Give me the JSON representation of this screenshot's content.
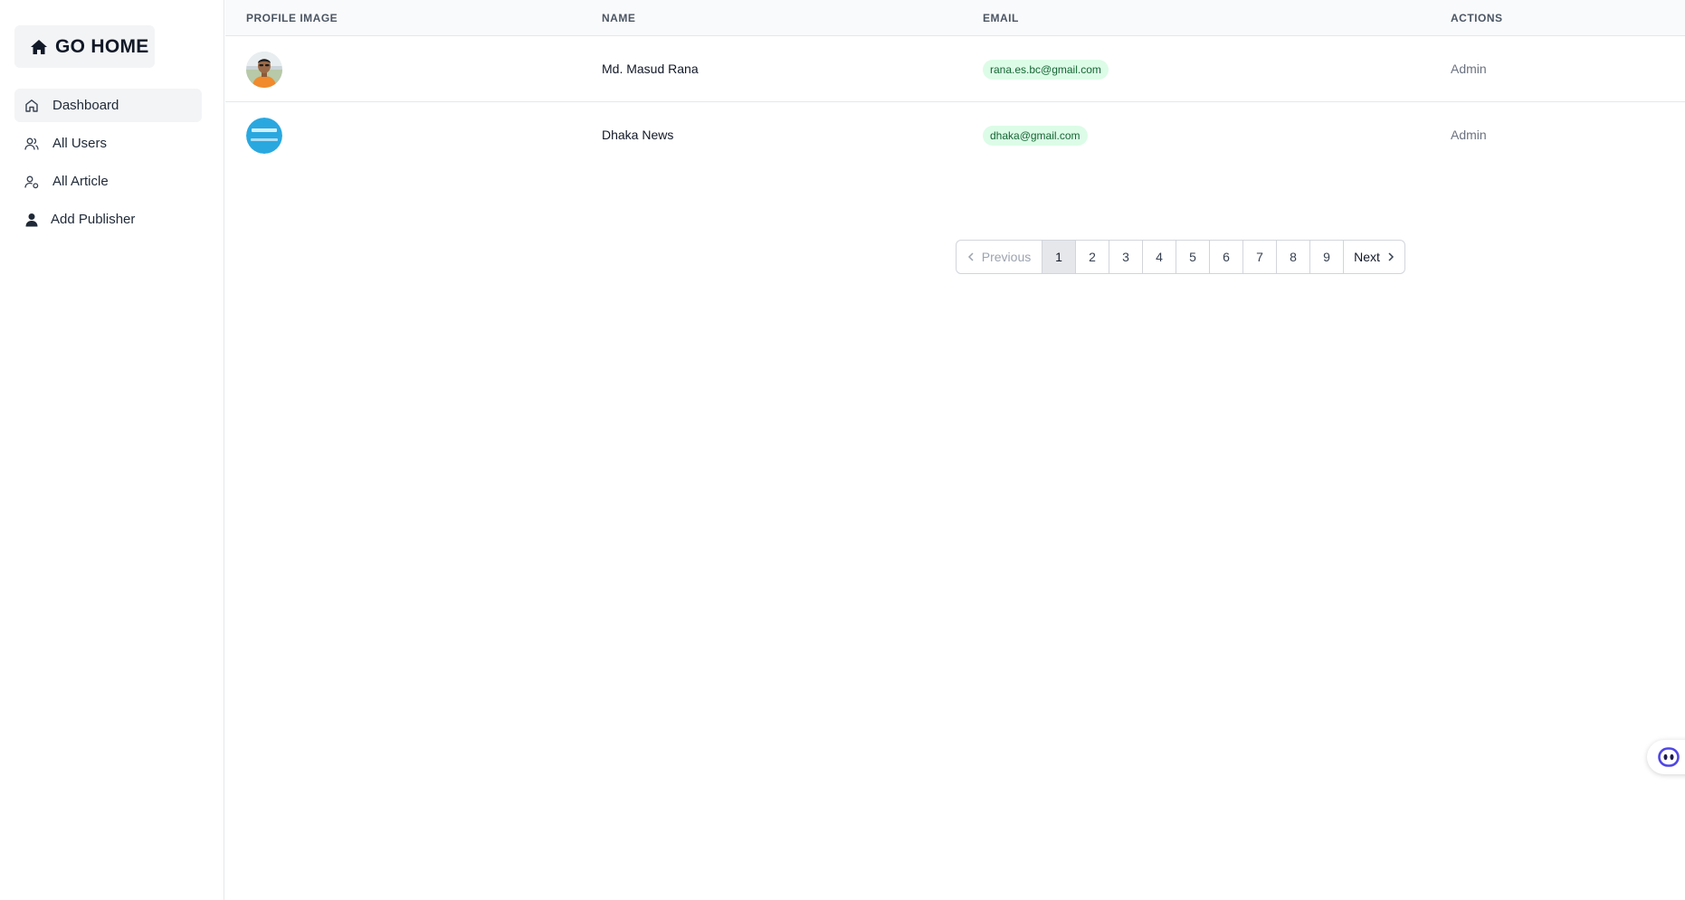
{
  "sidebar": {
    "home_label": "GO HOME",
    "items": [
      {
        "label": "Dashboard",
        "icon": "home-outline-icon",
        "active": true
      },
      {
        "label": "All Users",
        "icon": "users-icon",
        "active": false
      },
      {
        "label": "All Article",
        "icon": "user-settings-icon",
        "active": false
      },
      {
        "label": "Add Publisher",
        "icon": "user-solid-icon",
        "active": false
      }
    ]
  },
  "table": {
    "headers": [
      "PROFILE IMAGE",
      "NAME",
      "EMAIL",
      "ACTIONS"
    ],
    "rows": [
      {
        "name": "Md. Masud Rana",
        "email": "rana.es.bc@gmail.com",
        "action": "Admin",
        "avatar": "photo-avatar"
      },
      {
        "name": "Dhaka News",
        "email": "dhaka@gmail.com",
        "action": "Admin",
        "avatar": "logo-avatar"
      }
    ]
  },
  "pagination": {
    "prev": "Previous",
    "next": "Next",
    "pages": [
      "1",
      "2",
      "3",
      "4",
      "5",
      "6",
      "7",
      "8",
      "9"
    ],
    "current": "1"
  },
  "colors": {
    "email_badge_bg": "#dcfce7",
    "email_badge_text": "#166534",
    "active_nav_bg": "#f3f4f6",
    "widget_accent": "#4f46e5"
  }
}
